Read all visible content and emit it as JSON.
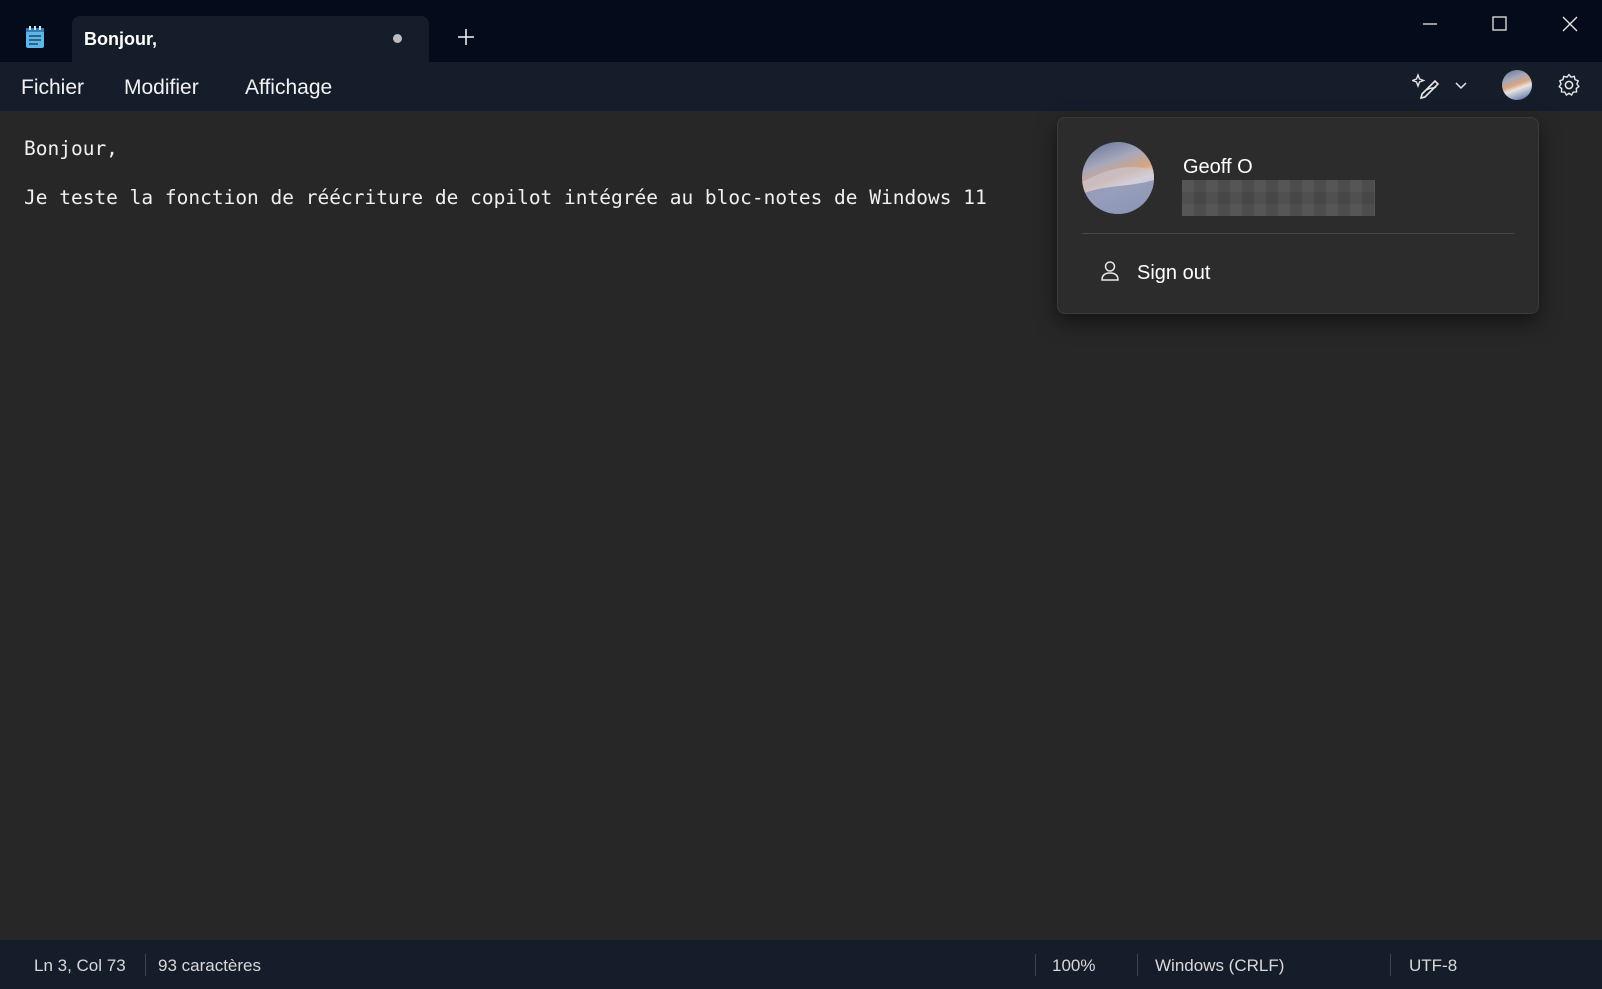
{
  "tab": {
    "title": "Bonjour,"
  },
  "menu": {
    "items": [
      "Fichier",
      "Modifier",
      "Affichage"
    ]
  },
  "editor": {
    "lines": [
      "Bonjour,",
      "Je teste la fonction de réécriture de copilot intégrée au bloc-notes de Windows 11"
    ]
  },
  "status": {
    "position": "Ln 3, Col 73",
    "chars": "93 caractères",
    "zoom": "100%",
    "line_ending": "Windows (CRLF)",
    "encoding": "UTF-8"
  },
  "account": {
    "name": "Geoff O",
    "sign_out": "Sign out"
  },
  "icons": {
    "app": "notepad-icon",
    "new_tab": "plus-icon",
    "copilot": "copilot-rewrite-icon",
    "settings": "gear-icon",
    "sign_out": "person-icon"
  },
  "colors": {
    "titlebar": "#040b1a",
    "chrome": "#161d2a",
    "editor_bg": "#272727",
    "popup_bg": "#2c2c2c"
  }
}
